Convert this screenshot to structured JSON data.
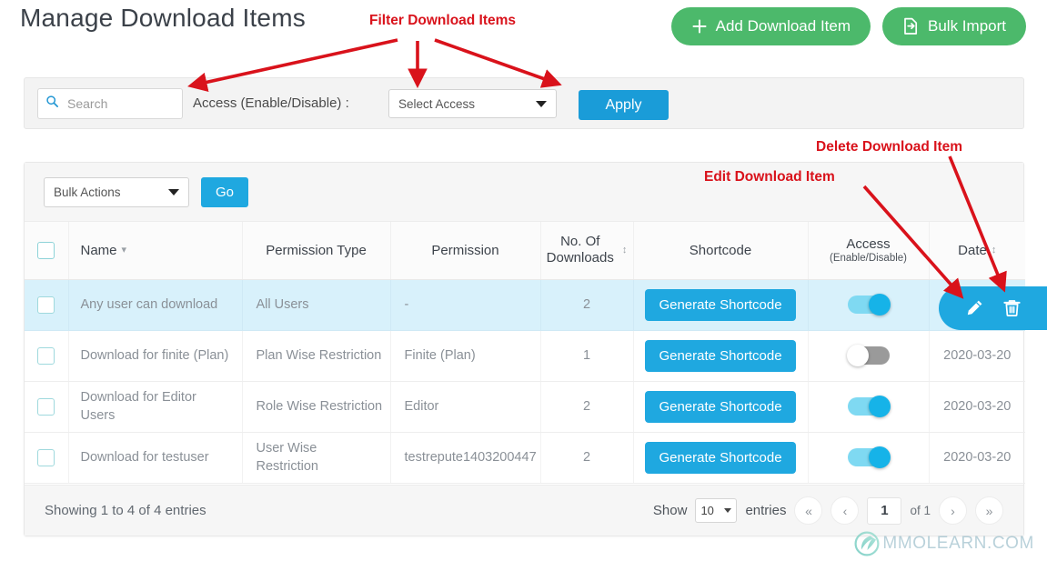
{
  "page": {
    "title": "Manage Download Items"
  },
  "top_actions": {
    "add_label": "Add Download Item",
    "add_icon": "plus-icon",
    "bulk_import_label": "Bulk Import",
    "bulk_import_icon": "import-file-icon",
    "color": "#4cb96b"
  },
  "filter": {
    "search_placeholder": "Search",
    "search_value": "",
    "search_icon": "search-icon",
    "access_label": "Access (Enable/Disable) :",
    "select_access_value": "Select Access",
    "apply_label": "Apply",
    "apply_color": "#1a9cd8"
  },
  "bulk_bar": {
    "bulk_actions_value": "Bulk Actions",
    "go_label": "Go",
    "go_color": "#1fa8e0"
  },
  "table": {
    "columns": [
      {
        "label": "Name",
        "sortable": true
      },
      {
        "label": "Permission Type",
        "sortable": false
      },
      {
        "label": "Permission",
        "sortable": false
      },
      {
        "label": "No. Of Downloads",
        "sortable": true
      },
      {
        "label": "Shortcode",
        "sortable": false
      },
      {
        "label": "Access",
        "sub": "(Enable/Disable)",
        "sortable": false
      },
      {
        "label": "Date",
        "sortable": true
      }
    ],
    "header": {
      "name": "Name",
      "permission_type": "Permission Type",
      "permission": "Permission",
      "no_of_downloads_line1": "No. Of",
      "no_of_downloads_line2": "Downloads",
      "shortcode": "Shortcode",
      "access": "Access",
      "access_sub": "(Enable/Disable)",
      "date": "Date"
    },
    "shortcode_button_label": "Generate Shortcode",
    "rows": [
      {
        "name": "Any user can download",
        "permission_type": "All Users",
        "permission": "-",
        "downloads": "2",
        "shortcode": "Generate Shortcode",
        "access_on": true,
        "date": "",
        "highlighted": true
      },
      {
        "name": "Download for finite (Plan)",
        "permission_type": "Plan Wise Restriction",
        "permission": "Finite (Plan)",
        "downloads": "1",
        "shortcode": "Generate Shortcode",
        "access_on": false,
        "date": "2020-03-20",
        "highlighted": false
      },
      {
        "name": "Download for Editor Users",
        "permission_type": "Role Wise Restriction",
        "permission": "Editor",
        "downloads": "2",
        "shortcode": "Generate Shortcode",
        "access_on": true,
        "date": "2020-03-20",
        "highlighted": false
      },
      {
        "name": "Download for testuser",
        "permission_type": "User Wise Restriction",
        "permission": "testrepute1403200447",
        "downloads": "2",
        "shortcode": "Generate Shortcode",
        "access_on": true,
        "date": "2020-03-20",
        "highlighted": false
      }
    ],
    "row_actions": {
      "edit_icon": "pencil-icon",
      "delete_icon": "trash-icon",
      "panel_color": "#1fa8e0"
    }
  },
  "footer": {
    "showing": "Showing 1 to 4 of 4 entries",
    "show_label": "Show",
    "page_length": "10",
    "entries_label": "entries",
    "first_page": "«",
    "prev_page": "‹",
    "current_page": "1",
    "of_pages": "of 1",
    "next_page": "›",
    "last_page": "»"
  },
  "annotations": [
    {
      "text": "Filter Download Items",
      "color": "#d9121b"
    },
    {
      "text": "Delete Download Item",
      "color": "#d9121b"
    },
    {
      "text": "Edit Download Item",
      "color": "#d9121b"
    }
  ],
  "annotation_labels": {
    "filter": "Filter Download Items",
    "delete": "Delete Download Item",
    "edit": "Edit Download Item"
  },
  "watermark": {
    "text": "MMOLEARN.COM",
    "logo_icon": "mmolearn-logo-icon"
  }
}
